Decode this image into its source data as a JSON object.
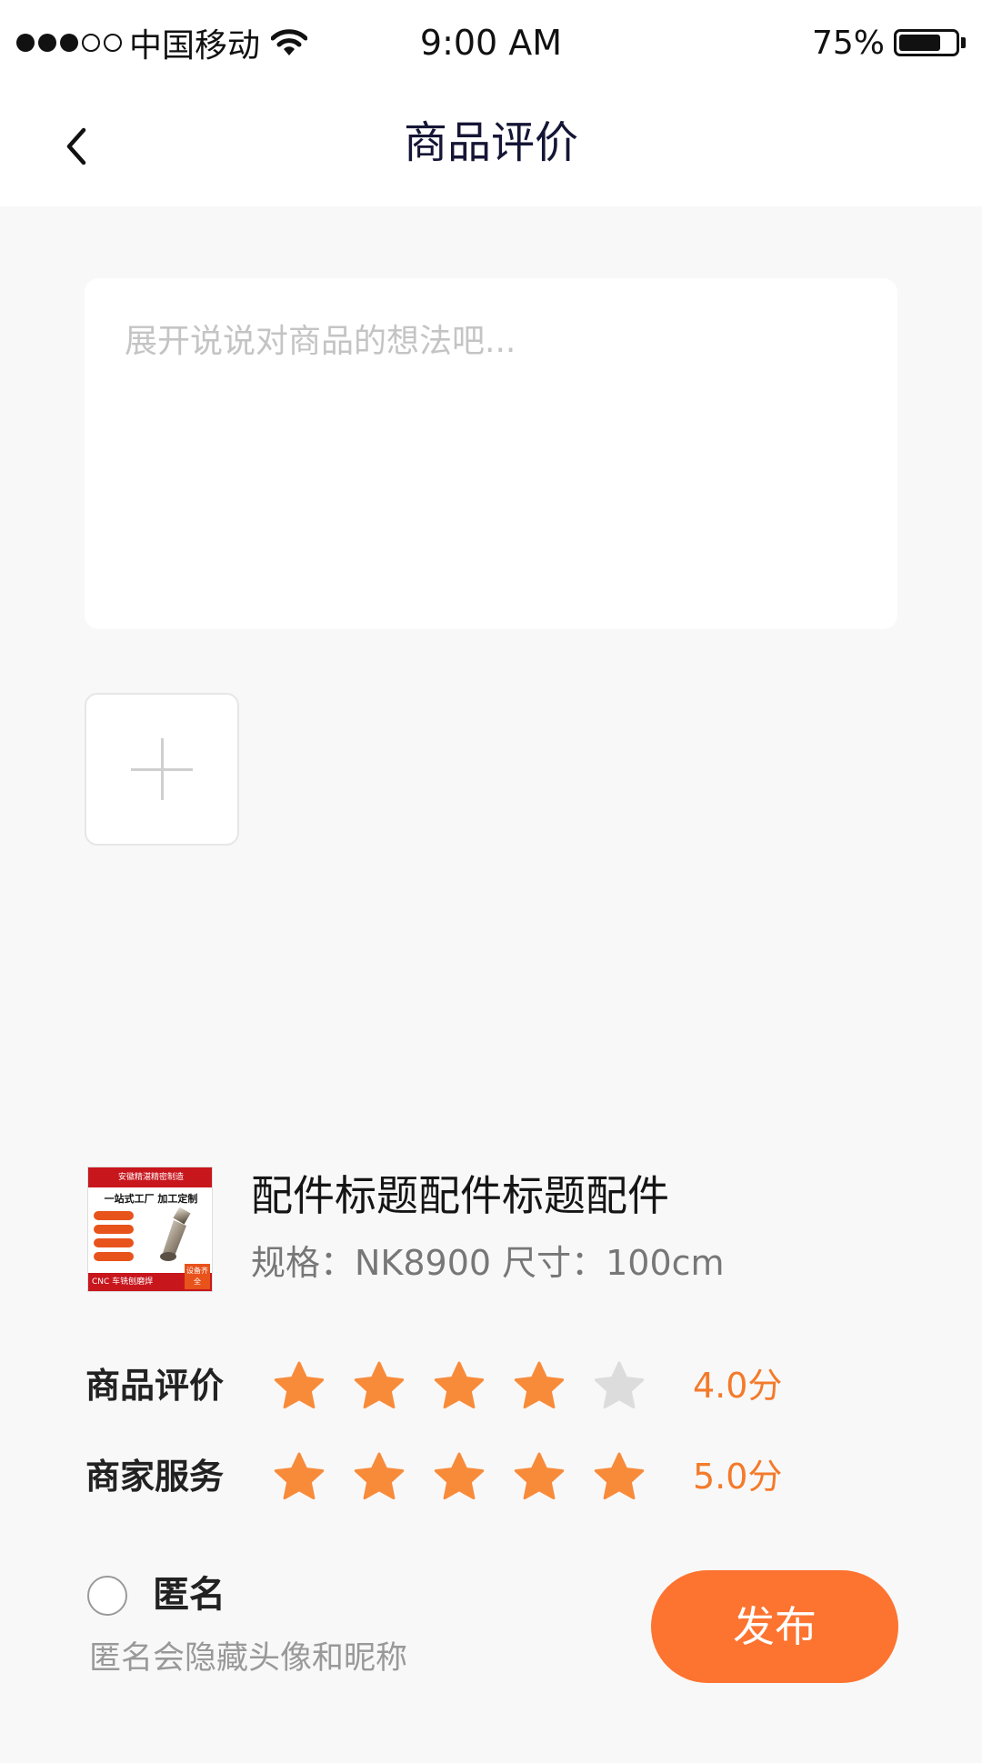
{
  "status_bar": {
    "carrier": "中国移动",
    "time": "9:00 AM",
    "battery": "75%",
    "battery_level": 0.75
  },
  "nav": {
    "title": "商品评价",
    "back_icon": "chevron-left-icon"
  },
  "review": {
    "placeholder": "展开说说对商品的想法吧...",
    "value": ""
  },
  "add_photo": {
    "icon": "plus-icon"
  },
  "product": {
    "title": "配件标题配件标题配件",
    "spec": "规格：NK8900 尺寸：100cm",
    "thumb_top": "安徽精湛精密制造",
    "thumb_mid": "一站式工厂 加工定制",
    "thumb_bottom": "CNC 车铣刨磨焊",
    "thumb_badge": "设备齐全"
  },
  "ratings": [
    {
      "label": "商品评价",
      "stars": 4,
      "max": 5,
      "score": "4.0分"
    },
    {
      "label": "商家服务",
      "stars": 5,
      "max": 5,
      "score": "5.0分"
    }
  ],
  "colors": {
    "accent": "#fd7330",
    "star_active": "#f88b3a",
    "star_inactive": "#dcdcdc"
  },
  "anonymous": {
    "label": "匿名",
    "hint": "匿名会隐藏头像和昵称",
    "checked": false
  },
  "publish": {
    "label": "发布"
  }
}
